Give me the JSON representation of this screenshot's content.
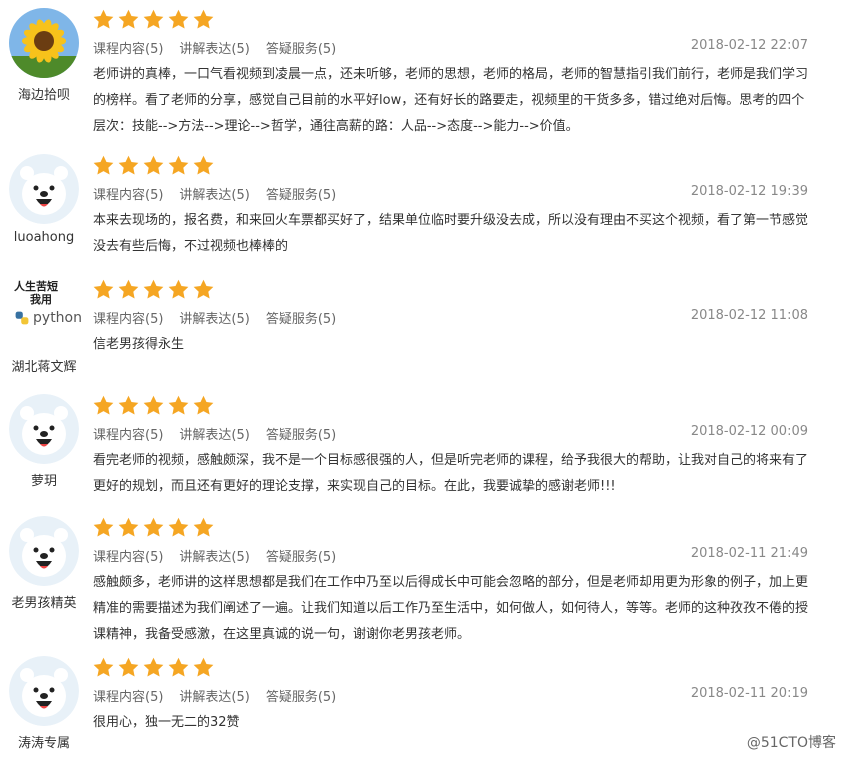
{
  "reviews": [
    {
      "user": "海边拾呗",
      "avatar": "sunflower",
      "date": "2018-02-12 22:07",
      "content": "老师讲的真棒，一口气看视频到凌晨一点，还未听够，老师的思想，老师的格局，老师的智慧指引我们前行，老师是我们学习的榜样。看了老师的分享，感觉自己目前的水平好low，还有好长的路要走，视频里的干货多多，错过绝对后悔。思考的四个层次：技能-->方法-->理论-->哲学，通往高薪的路：人品-->态度-->能力-->价值。"
    },
    {
      "user": "luoahong",
      "avatar": "bear",
      "date": "2018-02-12 19:39",
      "content": "本来去现场的，报名费，和来回火车票都买好了，结果单位临时要升级没去成，所以没有理由不买这个视频，看了第一节感觉没去有些后悔，不过视频也棒棒的"
    },
    {
      "user": "湖北蒋文辉",
      "avatar": "python",
      "date": "2018-02-12 11:08",
      "content": "信老男孩得永生"
    },
    {
      "user": "萝玥",
      "avatar": "bear",
      "date": "2018-02-12 00:09",
      "content": "看完老师的视频，感触颇深，我不是一个目标感很强的人，但是听完老师的课程，给予我很大的帮助，让我对自己的将来有了更好的规划，而且还有更好的理论支撑，来实现自己的目标。在此，我要诚挚的感谢老师!!!"
    },
    {
      "user": "老男孩精英",
      "avatar": "bear",
      "date": "2018-02-11 21:49",
      "content": "感触颇多，老师讲的这样思想都是我们在工作中乃至以后得成长中可能会忽略的部分，但是老师却用更为形象的例子，加上更精准的需要描述为我们阐述了一遍。让我们知道以后工作乃至生活中，如何做人，如何待人，等等。老师的这种孜孜不倦的授课精神，我备受感激，在这里真诚的说一句，谢谢你老男孩老师。"
    },
    {
      "user": "涛涛专属",
      "avatar": "bear",
      "date": "2018-02-11 20:19",
      "content": "很用心，独一无二的32赞"
    }
  ],
  "rating_labels": [
    "课程内容(5)",
    "讲解表达(5)",
    "答疑服务(5)"
  ],
  "stars": 5,
  "python_avatar_text": {
    "line1": "人生苦短",
    "line2": "我用",
    "line3": "python"
  },
  "watermark": "@51CTO博客",
  "colors": {
    "star": "#f5a623",
    "text": "#333333",
    "muted": "#666666",
    "date": "#888888",
    "bear_bg": "#e8f1f8"
  }
}
